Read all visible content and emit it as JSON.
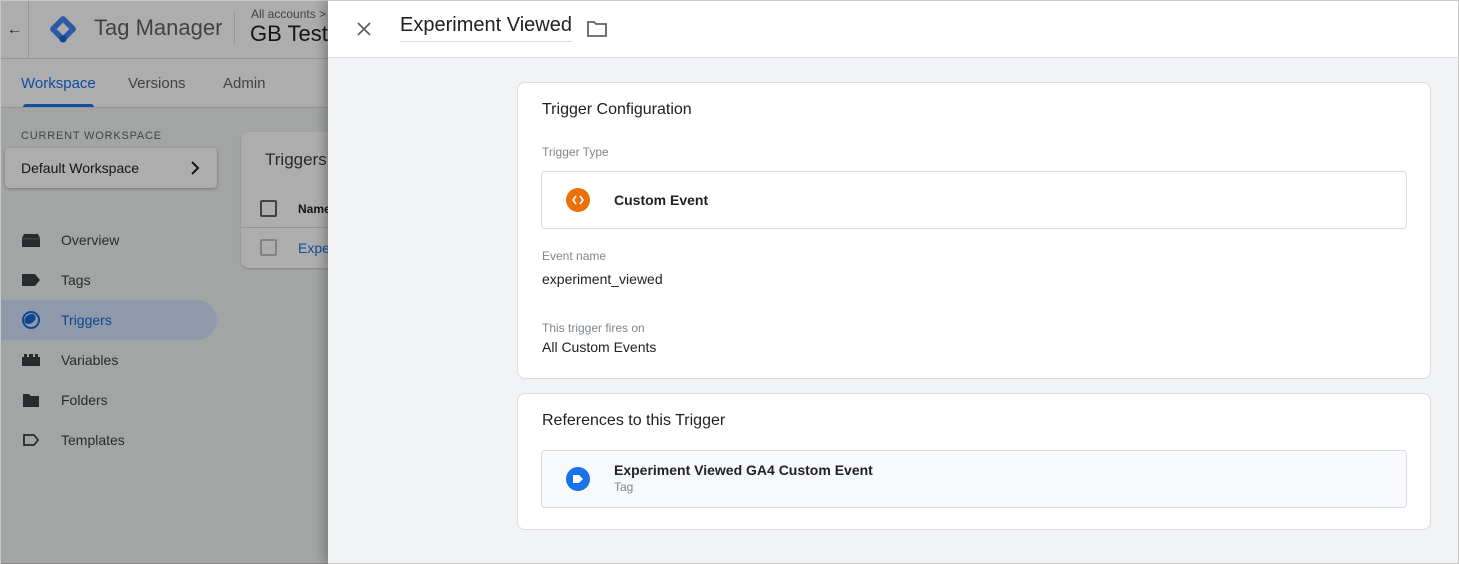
{
  "app": {
    "name": "Tag Manager",
    "breadcrumb_small": "All accounts >",
    "breadcrumb_container": "GB Test",
    "back_icon": "arrow-left-icon"
  },
  "tabs": [
    {
      "label": "Workspace",
      "active": true
    },
    {
      "label": "Versions",
      "active": false
    },
    {
      "label": "Admin",
      "active": false
    }
  ],
  "workspace": {
    "section_label": "CURRENT WORKSPACE",
    "current": "Default Workspace"
  },
  "sidebar": {
    "items": [
      {
        "label": "Overview",
        "icon": "overview-icon",
        "active": false
      },
      {
        "label": "Tags",
        "icon": "tag-icon",
        "active": false
      },
      {
        "label": "Triggers",
        "icon": "trigger-icon",
        "active": true
      },
      {
        "label": "Variables",
        "icon": "variables-icon",
        "active": false
      },
      {
        "label": "Folders",
        "icon": "folder-icon",
        "active": false
      },
      {
        "label": "Templates",
        "icon": "template-icon",
        "active": false
      }
    ]
  },
  "triggers_list": {
    "title": "Triggers",
    "column_name": "Name",
    "rows": [
      {
        "name": "Expe"
      }
    ]
  },
  "panel": {
    "title": "Experiment Viewed",
    "close_icon": "close-icon",
    "folder_icon": "folder-outline-icon"
  },
  "trigger_config": {
    "title": "Trigger Configuration",
    "type_label": "Trigger Type",
    "type_value": "Custom Event",
    "type_icon_color": "#e8710a",
    "event_name_label": "Event name",
    "event_name_value": "experiment_viewed",
    "fires_on_label": "This trigger fires on",
    "fires_on_value": "All Custom Events"
  },
  "references": {
    "title": "References to this Trigger",
    "items": [
      {
        "name": "Experiment Viewed GA4 Custom Event",
        "type": "Tag",
        "icon_color": "#1a73e8"
      }
    ]
  },
  "colors": {
    "accent": "#1a73e8",
    "custom_event_orange": "#e8710a",
    "panel_bg": "#f1f3f4"
  }
}
